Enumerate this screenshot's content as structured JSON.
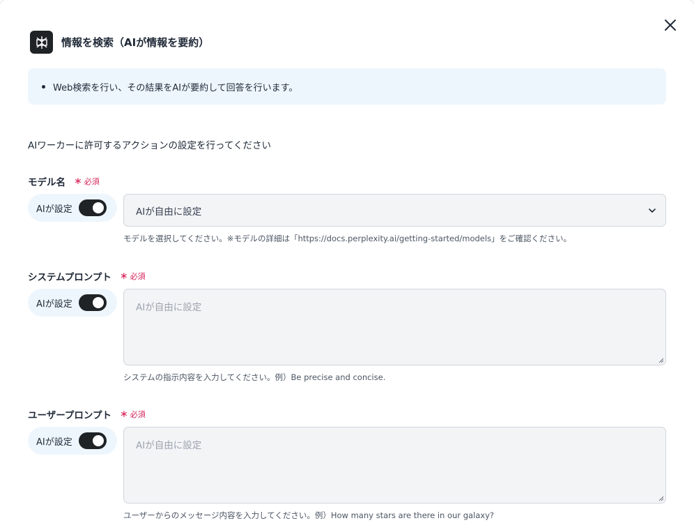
{
  "modal": {
    "title": "情報を検索（AIが情報を要約）",
    "description": "Web検索を行い、その結果をAIが要約して回答を行います。",
    "intro": "AIワーカーに許可するアクションの設定を行ってください"
  },
  "fields": [
    {
      "label": "モデル名",
      "required": "必須",
      "toggle_label": "AIが設定",
      "toggle_on": true,
      "value": "AIが自由に設定",
      "help": "モデルを選択してください。※モデルの詳細は「https://docs.perplexity.ai/getting-started/models」をご確認ください。"
    },
    {
      "label": "システムプロンプト",
      "required": "必須",
      "toggle_label": "AIが設定",
      "toggle_on": true,
      "placeholder": "AIが自由に設定",
      "help": "システムの指示内容を入力してください。例）Be precise and concise."
    },
    {
      "label": "ユーザープロンプト",
      "required": "必須",
      "toggle_label": "AIが設定",
      "toggle_on": true,
      "placeholder": "AIが自由に設定",
      "help": "ユーザーからのメッセージ内容を入力してください。例）How many stars are there in our galaxy?"
    }
  ],
  "colors": {
    "accent_dark": "#1f2326",
    "info_bg": "#eef6fd",
    "required": "#d6245a"
  },
  "icons": {
    "close": "close-icon",
    "logo": "perplexity-logo-icon",
    "select": "chevron-down-icon"
  }
}
